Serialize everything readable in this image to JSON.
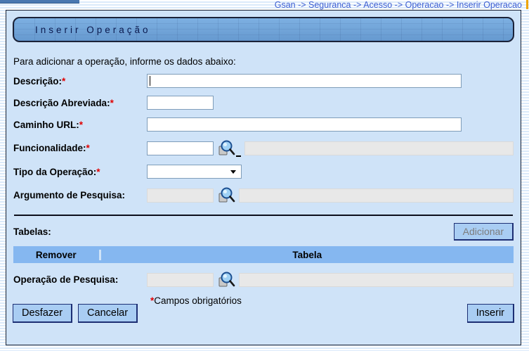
{
  "breadcrumb": {
    "text": "Gsan -> Seguranca -> Acesso -> Operacao -> Inserir Operacao"
  },
  "header": {
    "title": "Inserir Operação"
  },
  "intro": "Para adicionar a operação, informe os dados abaixo:",
  "fields": {
    "descricao": {
      "label": "Descrição:",
      "required": "*",
      "value": ""
    },
    "descricao_abreviada": {
      "label": "Descrição Abreviada:",
      "required": "*",
      "value": ""
    },
    "caminho_url": {
      "label": "Caminho URL:",
      "required": "*",
      "value": ""
    },
    "funcionalidade": {
      "label": "Funcionalidade:",
      "required": "*",
      "value": "",
      "display_value": ""
    },
    "tipo_operacao": {
      "label": "Tipo da Operação:",
      "required": "*",
      "selected": ""
    },
    "argumento_pesquisa": {
      "label": "Argumento de Pesquisa:",
      "value": "",
      "display_value": ""
    },
    "operacao_pesquisa": {
      "label": "Operação de Pesquisa:",
      "value": "",
      "display_value": ""
    }
  },
  "tabelas": {
    "label": "Tabelas:",
    "add_button_label": "Adicionar",
    "columns": [
      "Remover",
      "Tabela"
    ],
    "rows": []
  },
  "footer_note": {
    "asterisk": "*",
    "text": "Campos obrigatórios"
  },
  "actions": {
    "desfazer": "Desfazer",
    "cancelar": "Cancelar",
    "inserir": "Inserir"
  },
  "icons": {
    "search": "magnifier-icon"
  },
  "colors": {
    "breadcrumb_blue": "#3c5ed2",
    "accent_orange": "#efa400",
    "panel_bg": "#cfe3f8",
    "titlebar_bg": "#6fa6db",
    "table_header_bg": "#85b7f0",
    "button_bg": "#a9cdf3",
    "disabled_text": "#7d7d7d",
    "required_red": "#e00000",
    "readonly_bg": "#e8e8e8"
  }
}
